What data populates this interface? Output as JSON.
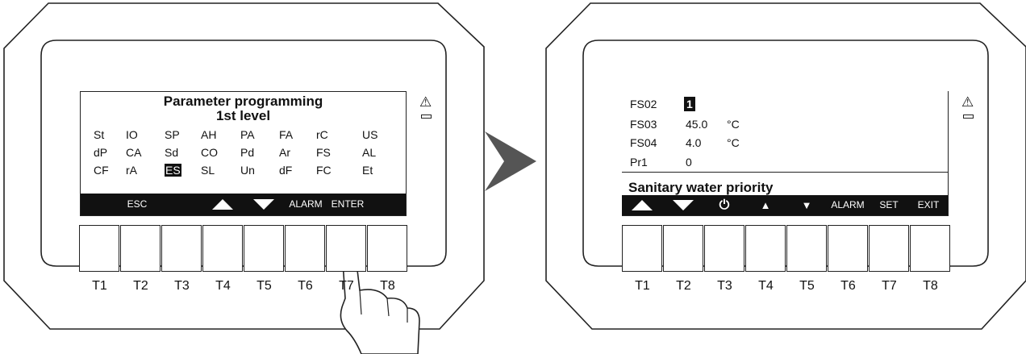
{
  "left_panel": {
    "title_line1": "Parameter programming",
    "title_line2": "1st level",
    "params": [
      [
        "St",
        "IO",
        "SP",
        "AH",
        "PA",
        "FA",
        "rC",
        "US"
      ],
      [
        "dP",
        "CA",
        "Sd",
        "CO",
        "Pd",
        "Ar",
        "FS",
        "AL"
      ],
      [
        "CF",
        "rA",
        "ES",
        "SL",
        "Un",
        "dF",
        "FC",
        "Et"
      ]
    ],
    "selected_param": "ES",
    "softkeys": [
      "",
      "ESC",
      "",
      "up-arrow-icon",
      "down-arrow-icon",
      "ALARM",
      "ENTER",
      ""
    ],
    "softkey_labels": {
      "esc": "ESC",
      "alarm": "ALARM",
      "enter": "ENTER"
    }
  },
  "right_panel": {
    "rows": [
      {
        "code": "FS02",
        "value": "1",
        "unit": ""
      },
      {
        "code": "FS03",
        "value": "45.0",
        "unit": "°C"
      },
      {
        "code": "FS04",
        "value": "4.0",
        "unit": "°C"
      },
      {
        "code": "Pr1",
        "value": "0",
        "unit": ""
      }
    ],
    "description": "Sanitary water priority",
    "softkey_labels": {
      "alarm": "ALARM",
      "set": "SET",
      "exit": "EXIT"
    }
  },
  "button_labels": [
    "T1",
    "T2",
    "T3",
    "T4",
    "T5",
    "T6",
    "T7",
    "T8"
  ],
  "warning_symbol": "⚠",
  "icons": [
    "warning-icon",
    "hand-pointer-icon",
    "arrow-right-icon",
    "power-icon",
    "double-up-icon",
    "double-down-icon"
  ]
}
